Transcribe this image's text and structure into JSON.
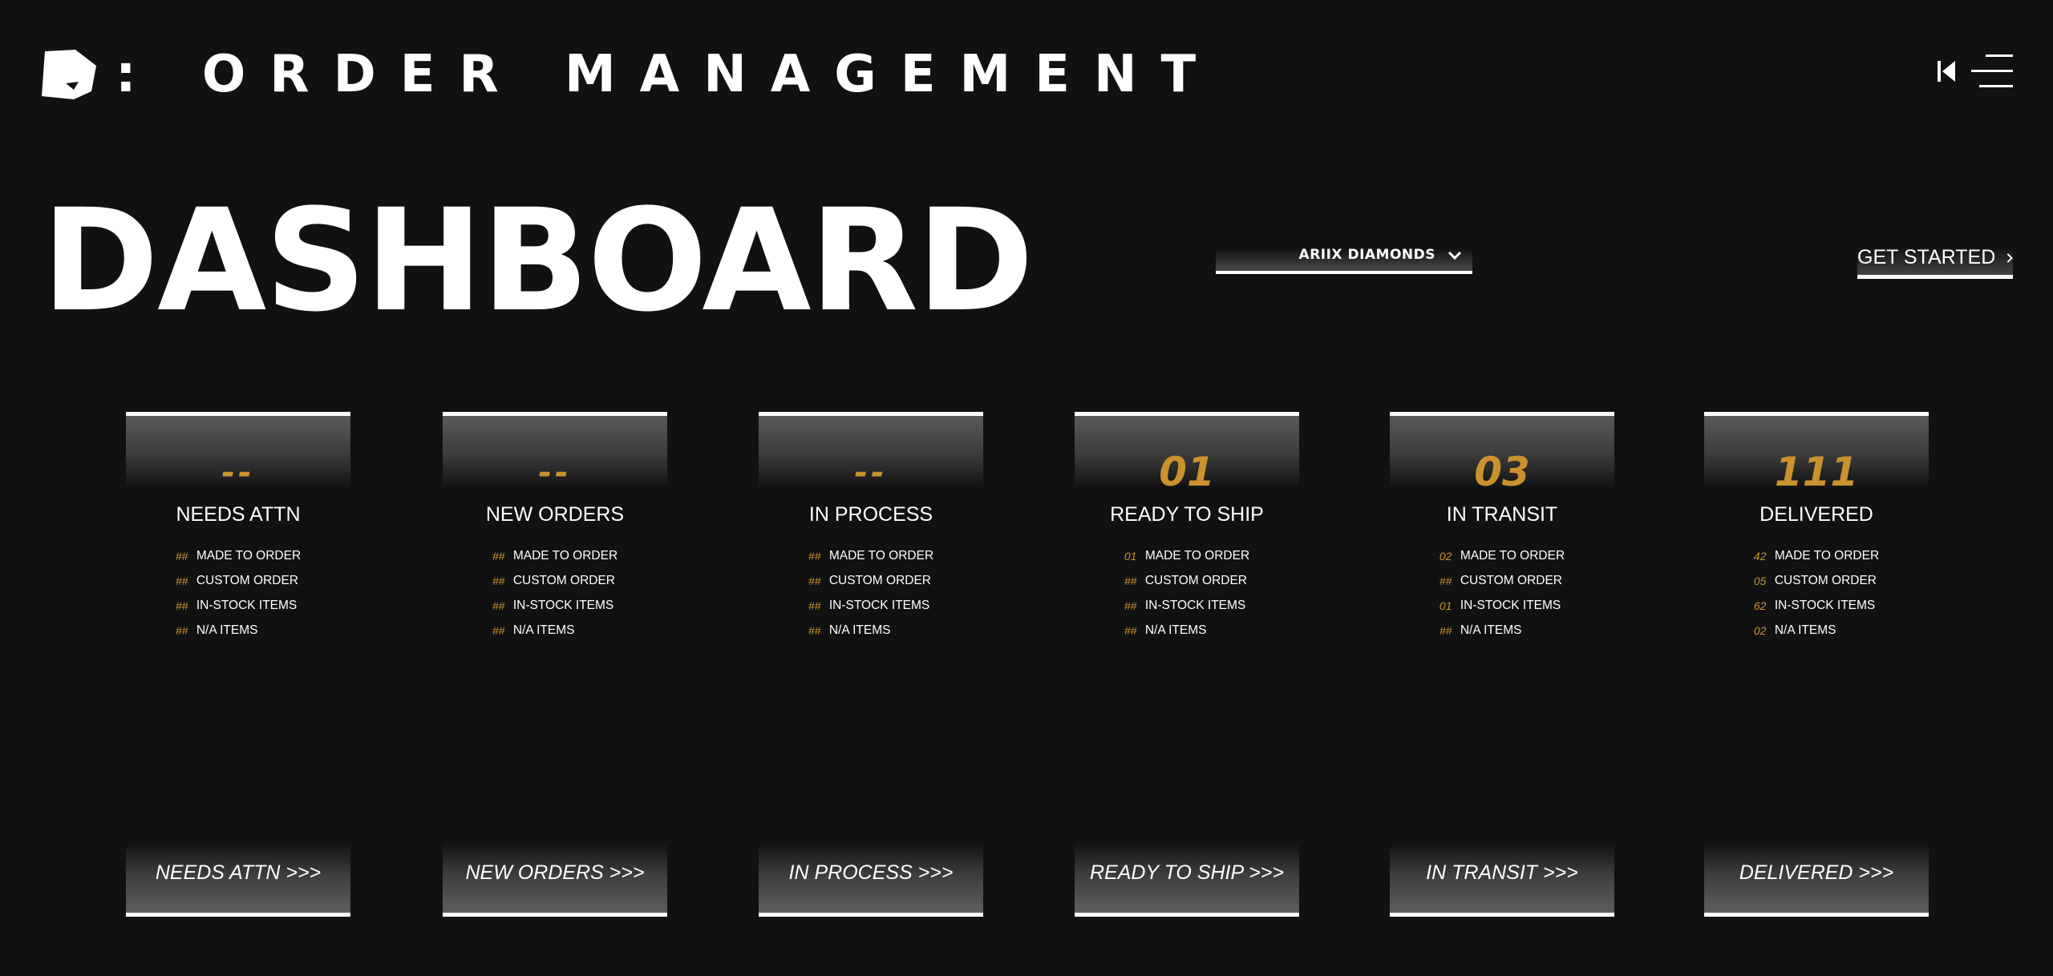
{
  "header": {
    "title": ":  ORDER MANAGEMENT",
    "logo_icon": "diamond-shape-icon",
    "collapse_icon": "skip-back-icon",
    "menu_icon": "hamburger-menu-icon"
  },
  "page_title": "DASHBOARD",
  "account_select": {
    "value": "ARIIX DIAMONDS",
    "icon": "chevron-down-icon"
  },
  "get_started": {
    "label": "GET STARTED",
    "icon": "chevron-right-icon"
  },
  "colors": {
    "background": "#111111",
    "accent": "#c9922f",
    "text": "#ffffff"
  },
  "cards": [
    {
      "count": "--",
      "title": "NEEDS ATTN",
      "button": "NEEDS ATTN >>>",
      "rows": [
        {
          "count": "##",
          "label": "MADE TO ORDER"
        },
        {
          "count": "##",
          "label": "CUSTOM ORDER"
        },
        {
          "count": "##",
          "label": "IN-STOCK ITEMS"
        },
        {
          "count": "##",
          "label": "N/A ITEMS"
        }
      ]
    },
    {
      "count": "--",
      "title": "NEW ORDERS",
      "button": "NEW ORDERS >>>",
      "rows": [
        {
          "count": "##",
          "label": "MADE TO ORDER"
        },
        {
          "count": "##",
          "label": "CUSTOM ORDER"
        },
        {
          "count": "##",
          "label": "IN-STOCK ITEMS"
        },
        {
          "count": "##",
          "label": "N/A ITEMS"
        }
      ]
    },
    {
      "count": "--",
      "title": "IN PROCESS",
      "button": "IN PROCESS >>>",
      "rows": [
        {
          "count": "##",
          "label": "MADE TO ORDER"
        },
        {
          "count": "##",
          "label": "CUSTOM ORDER"
        },
        {
          "count": "##",
          "label": "IN-STOCK ITEMS"
        },
        {
          "count": "##",
          "label": "N/A ITEMS"
        }
      ]
    },
    {
      "count": "01",
      "title": "READY TO SHIP",
      "button": "READY TO SHIP >>>",
      "rows": [
        {
          "count": "01",
          "label": "MADE TO ORDER"
        },
        {
          "count": "##",
          "label": "CUSTOM ORDER"
        },
        {
          "count": "##",
          "label": "IN-STOCK ITEMS"
        },
        {
          "count": "##",
          "label": "N/A ITEMS"
        }
      ]
    },
    {
      "count": "03",
      "title": "IN TRANSIT",
      "button": "IN TRANSIT >>>",
      "rows": [
        {
          "count": "02",
          "label": "MADE TO ORDER"
        },
        {
          "count": "##",
          "label": "CUSTOM ORDER"
        },
        {
          "count": "01",
          "label": "IN-STOCK ITEMS"
        },
        {
          "count": "##",
          "label": "N/A ITEMS"
        }
      ]
    },
    {
      "count": "111",
      "title": "DELIVERED",
      "button": "DELIVERED >>>",
      "rows": [
        {
          "count": "42",
          "label": "MADE TO ORDER"
        },
        {
          "count": "05",
          "label": "CUSTOM ORDER"
        },
        {
          "count": "62",
          "label": "IN-STOCK ITEMS"
        },
        {
          "count": "02",
          "label": "N/A ITEMS"
        }
      ]
    }
  ]
}
